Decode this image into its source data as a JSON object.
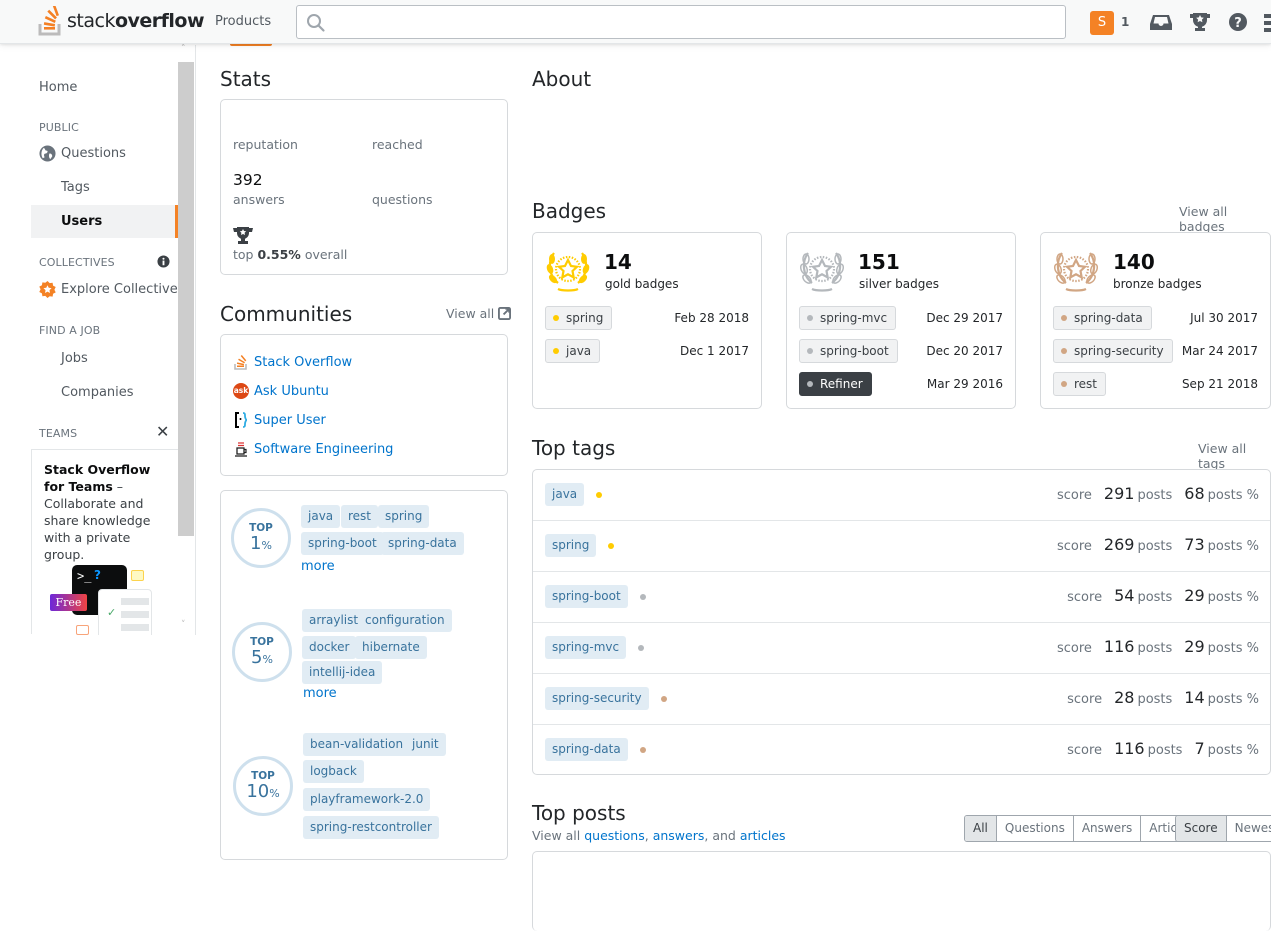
{
  "topbar": {
    "logo_light": "stack",
    "logo_bold": "overflow",
    "products_label": "Products",
    "search_placeholder": "",
    "avatar_letter": "S",
    "reputation": "1",
    "icons": [
      "inbox-icon",
      "achievements-icon",
      "help-icon"
    ]
  },
  "sidebar": {
    "home": "Home",
    "public_heading": "PUBLIC",
    "questions": "Questions",
    "tags": "Tags",
    "users": "Users",
    "collectives_heading": "COLLECTIVES",
    "explore_collectives": "Explore Collectives",
    "find_job_heading": "FIND A JOB",
    "jobs": "Jobs",
    "companies": "Companies",
    "teams_heading": "TEAMS",
    "teams_promo_bold1": "Stack Overflow for Teams",
    "teams_promo_text": " – Collaborate and share knowledge with a private group.",
    "free_label": "Free",
    "terminal_prompt": ">_",
    "terminal_q": "?"
  },
  "stats": {
    "title": "Stats",
    "reputation_label": "reputation",
    "reached_label": "reached",
    "answers_value": "392",
    "answers_label": "answers",
    "questions_label": "questions",
    "top_prefix": "top ",
    "top_value": "0.55%",
    "top_suffix": " overall"
  },
  "communities": {
    "title": "Communities",
    "view_all": "View all",
    "items": [
      {
        "name": "Stack Overflow",
        "icon": "stackoverflow-icon"
      },
      {
        "name": "Ask Ubuntu",
        "icon": "askubuntu-icon"
      },
      {
        "name": "Super User",
        "icon": "superuser-icon"
      },
      {
        "name": "Software Engineering",
        "icon": "softwareengineering-icon"
      }
    ]
  },
  "top_percent": [
    {
      "top": "TOP",
      "pct": "1",
      "unit": "%",
      "tags": [
        "java",
        "rest",
        "spring",
        "spring-boot",
        "spring-data"
      ],
      "more": "more"
    },
    {
      "top": "TOP",
      "pct": "5",
      "unit": "%",
      "tags": [
        "arraylist",
        "configuration",
        "docker",
        "hibernate",
        "intellij-idea"
      ],
      "more": "more"
    },
    {
      "top": "TOP",
      "pct": "10",
      "unit": "%",
      "tags": [
        "bean-validation",
        "junit",
        "logback",
        "playframework-2.0",
        "spring-restcontroller"
      ]
    }
  ],
  "about": {
    "title": "About"
  },
  "badges": {
    "title": "Badges",
    "view_all": "View all badges",
    "colors": {
      "gold": "#ffcc01",
      "silver": "#b4b8bc",
      "bronze": "#d1a684"
    },
    "groups": [
      {
        "count": "14",
        "type": "gold badges",
        "items": [
          {
            "name": "spring",
            "date": "Feb 28 2018"
          },
          {
            "name": "java",
            "date": "Dec 1 2017"
          }
        ]
      },
      {
        "count": "151",
        "type": "silver badges",
        "items": [
          {
            "name": "spring-mvc",
            "date": "Dec 29 2017"
          },
          {
            "name": "spring-boot",
            "date": "Dec 20 2017"
          },
          {
            "name": "Refiner",
            "date": "Mar 29 2016",
            "dark": true
          }
        ]
      },
      {
        "count": "140",
        "type": "bronze badges",
        "items": [
          {
            "name": "spring-data",
            "date": "Jul 30 2017"
          },
          {
            "name": "spring-security",
            "date": "Mar 24 2017"
          },
          {
            "name": "rest",
            "date": "Sep 21 2018"
          }
        ]
      }
    ]
  },
  "top_tags": {
    "title": "Top tags",
    "view_all": "View all tags",
    "score_label": "score",
    "posts_label": "posts",
    "posts_pct_label": "posts %",
    "rows": [
      {
        "tag": "java",
        "badge": "gold",
        "score": "291",
        "posts_pct": "68"
      },
      {
        "tag": "spring",
        "badge": "gold",
        "score": "269",
        "posts_pct": "73"
      },
      {
        "tag": "spring-boot",
        "badge": "silver",
        "score": "54",
        "posts_pct": "29"
      },
      {
        "tag": "spring-mvc",
        "badge": "silver",
        "score": "116",
        "posts_pct": "29"
      },
      {
        "tag": "spring-security",
        "badge": "bronze",
        "score": "28",
        "posts_pct": "14"
      },
      {
        "tag": "spring-data",
        "badge": "bronze",
        "score": "116",
        "posts_pct": "7"
      }
    ]
  },
  "top_posts": {
    "title": "Top posts",
    "view_all_prefix": "View all ",
    "questions_link": "questions",
    "sep1": ", ",
    "answers_link": "answers",
    "sep2": ", and ",
    "articles_link": "articles",
    "filter_tabs": [
      "All",
      "Questions",
      "Answers",
      "Articles"
    ],
    "filter_selected": "All",
    "sort_tabs": [
      "Score",
      "Newest"
    ],
    "sort_selected": "Score"
  }
}
